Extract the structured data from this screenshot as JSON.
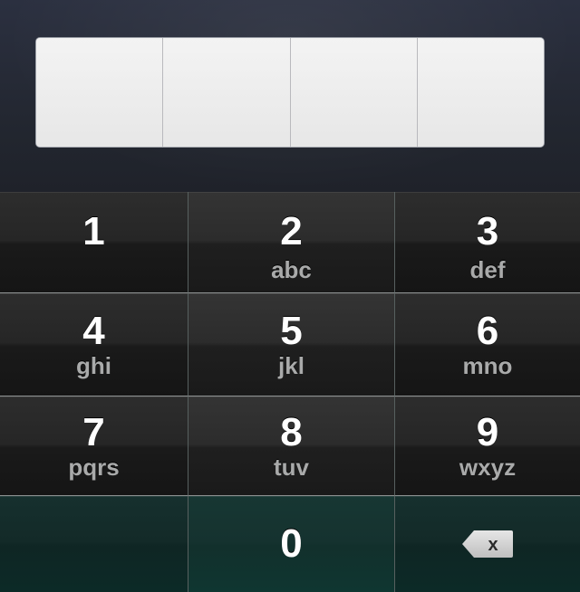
{
  "passcode": {
    "box_count": 4
  },
  "keypad": {
    "keys": [
      {
        "digit": "1",
        "letters": ""
      },
      {
        "digit": "2",
        "letters": "abc"
      },
      {
        "digit": "3",
        "letters": "def"
      },
      {
        "digit": "4",
        "letters": "ghi"
      },
      {
        "digit": "5",
        "letters": "jkl"
      },
      {
        "digit": "6",
        "letters": "mno"
      },
      {
        "digit": "7",
        "letters": "pqrs"
      },
      {
        "digit": "8",
        "letters": "tuv"
      },
      {
        "digit": "9",
        "letters": "wxyz"
      },
      {
        "digit": "0",
        "letters": ""
      }
    ],
    "delete_icon_glyph": "x",
    "delete_icon": "delete-backspace-icon"
  },
  "colors": {
    "entry_background": "#262a35",
    "passcode_box": "#ececec",
    "key_background": "#242424",
    "bottom_row_tint": "#123330",
    "digit_text": "#ffffff",
    "letters_text": "#a9aaaa"
  }
}
